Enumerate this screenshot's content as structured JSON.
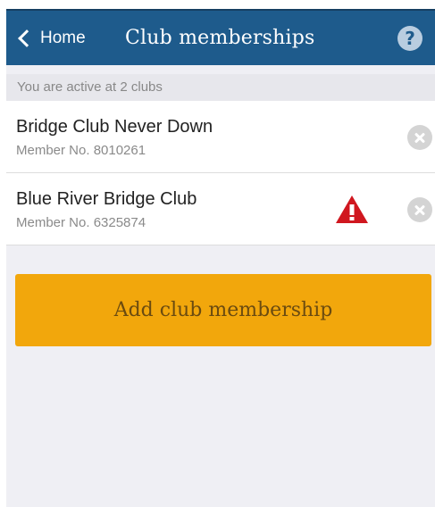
{
  "header": {
    "back_label": "Home",
    "title": "Club memberships",
    "help_glyph": "?"
  },
  "summary": "You are active at 2 clubs",
  "clubs": [
    {
      "name": "Bridge Club Never Down",
      "member_no": "Member No. 8010261",
      "warning": false
    },
    {
      "name": "Blue River Bridge Club",
      "member_no": "Member No. 6325874",
      "warning": true
    }
  ],
  "add_button_label": "Add club membership",
  "colors": {
    "header_bg": "#1e5b8c",
    "accent_button": "#f2a70c",
    "warning_red": "#d0171f"
  },
  "icons": [
    "chevron-left-icon",
    "help-icon",
    "remove-icon",
    "warning-icon"
  ]
}
